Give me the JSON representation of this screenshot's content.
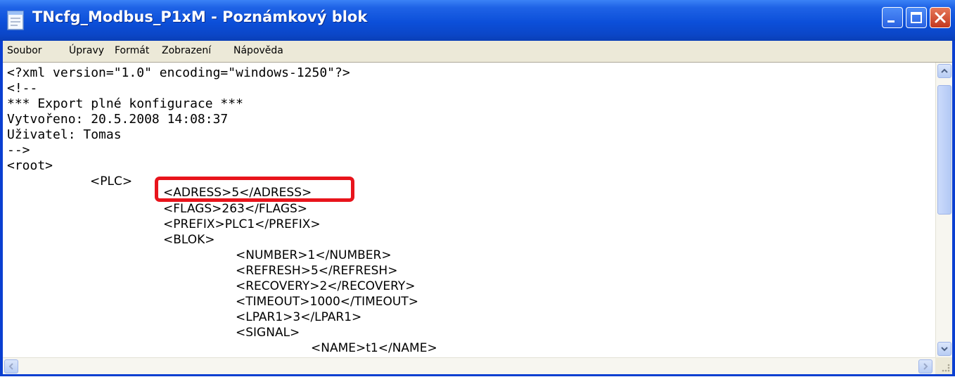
{
  "window": {
    "title": "TNcfg_Modbus_P1xM - Poznámkový blok"
  },
  "menu": [
    "Soubor",
    "Úpravy",
    "Formát",
    "Zobrazení",
    "Nápověda"
  ],
  "editor": {
    "lines": [
      "<?xml version=\"1.0\" encoding=\"windows-1250\"?>",
      "<!--",
      "*** Export plné konfigurace ***",
      "Vytvořeno: 20.5.2008 14:08:37",
      "Uživatel: Tomas",
      "-->",
      "<root>",
      "<PLC>",
      "<ADRESS>5</ADRESS>",
      "<FLAGS>263</FLAGS>",
      "<PREFIX>PLC1</PREFIX>",
      "<BLOK>",
      "<NUMBER>1</NUMBER>",
      "<REFRESH>5</REFRESH>",
      "<RECOVERY>2</RECOVERY>",
      "<TIMEOUT>1000</TIMEOUT>",
      "<LPAR1>3</LPAR1>",
      "<SIGNAL>",
      "<NAME>t1</NAME>"
    ],
    "highlighted_line": "<ADRESS>5</ADRESS>",
    "highlight_color": "#e8141c"
  },
  "colors": {
    "titlebar": "#0c4fd9",
    "menubar": "#ece9d8"
  }
}
